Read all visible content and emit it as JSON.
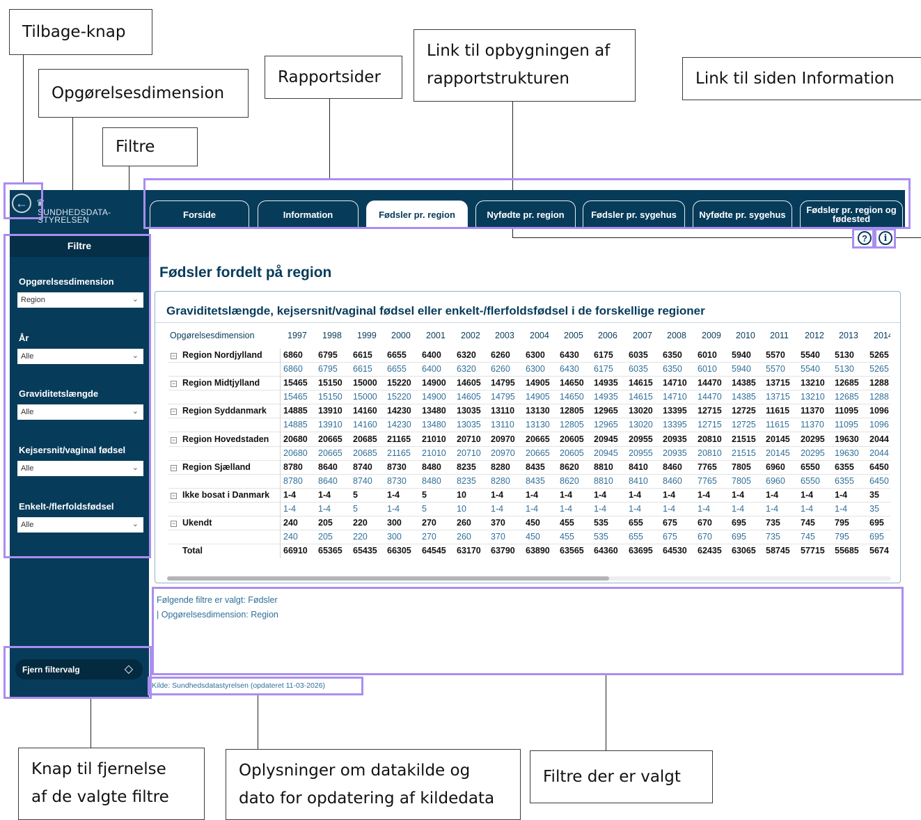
{
  "callouts": {
    "back": "Tilbage-knap",
    "dimension": "Opgørelsesdimension",
    "filters": "Filtre",
    "report_pages": "Rapportsider",
    "structure_line1": "Link til opbygningen af",
    "structure_line2": "rapportstrukturen",
    "information": "Link til siden Information",
    "clear_line1": "Knap til fjernelse",
    "clear_line2": "af de valgte filtre",
    "source_line1": "Oplysninger om datakilde og",
    "source_line2": "dato for opdatering af kildedata",
    "selected_filters": "Filtre der er valgt"
  },
  "logo": {
    "line1": "SUNDHEDSDATA-",
    "line2": "STYRELSEN"
  },
  "tabs": [
    "Forside",
    "Information",
    "Fødsler pr. region",
    "Nyfødte pr. region",
    "Fødsler pr. sygehus",
    "Nyfødte pr. sygehus",
    "Fødsler pr. region og fødested"
  ],
  "active_tab": "Fødsler pr. region",
  "sidebar": {
    "title": "Filtre",
    "filters": [
      {
        "label": "Opgørelsesdimension",
        "value": "Region"
      },
      {
        "label": "År",
        "value": "Alle"
      },
      {
        "label": "Graviditetslængde",
        "value": "Alle"
      },
      {
        "label": "Kejsersnit/vaginal fødsel",
        "value": "Alle"
      },
      {
        "label": "Enkelt-/flerfoldsfødsel",
        "value": "Alle"
      }
    ],
    "clear_button": "Fjern filtervalg"
  },
  "page_title": "Fødsler fordelt på region",
  "table": {
    "title": "Graviditetslængde, kejsersnit/vaginal fødsel eller enkelt-/flerfoldsfødsel i de forskellige regioner",
    "dimension_header": "Opgørelsesdimension",
    "years": [
      "1997",
      "1998",
      "1999",
      "2000",
      "2001",
      "2002",
      "2003",
      "2004",
      "2005",
      "2006",
      "2007",
      "2008",
      "2009",
      "2010",
      "2011",
      "2012",
      "2013",
      "2014"
    ],
    "rows": [
      {
        "label": "Region Nordjylland",
        "values": [
          "6860",
          "6795",
          "6615",
          "6655",
          "6400",
          "6320",
          "6260",
          "6300",
          "6430",
          "6175",
          "6035",
          "6350",
          "6010",
          "5940",
          "5570",
          "5540",
          "5130",
          "5265"
        ]
      },
      {
        "label": "Region Midtjylland",
        "values": [
          "15465",
          "15150",
          "15000",
          "15220",
          "14900",
          "14605",
          "14795",
          "14905",
          "14650",
          "14935",
          "14615",
          "14710",
          "14470",
          "14385",
          "13715",
          "13210",
          "12685",
          "1288"
        ]
      },
      {
        "label": "Region Syddanmark",
        "values": [
          "14885",
          "13910",
          "14160",
          "14230",
          "13480",
          "13035",
          "13110",
          "13130",
          "12805",
          "12965",
          "13020",
          "13395",
          "12715",
          "12725",
          "11615",
          "11370",
          "11095",
          "1096"
        ]
      },
      {
        "label": "Region Hovedstaden",
        "values": [
          "20680",
          "20665",
          "20685",
          "21165",
          "21010",
          "20710",
          "20970",
          "20665",
          "20605",
          "20945",
          "20955",
          "20935",
          "20810",
          "21515",
          "20145",
          "20295",
          "19630",
          "2044"
        ]
      },
      {
        "label": "Region Sjælland",
        "values": [
          "8780",
          "8640",
          "8740",
          "8730",
          "8480",
          "8235",
          "8280",
          "8435",
          "8620",
          "8810",
          "8410",
          "8460",
          "7765",
          "7805",
          "6960",
          "6550",
          "6355",
          "6450"
        ]
      },
      {
        "label": "Ikke bosat i Danmark",
        "values": [
          "1-4",
          "1-4",
          "5",
          "1-4",
          "5",
          "10",
          "1-4",
          "1-4",
          "1-4",
          "1-4",
          "1-4",
          "1-4",
          "1-4",
          "1-4",
          "1-4",
          "1-4",
          "1-4",
          "35"
        ]
      },
      {
        "label": "Ukendt",
        "values": [
          "240",
          "205",
          "220",
          "300",
          "270",
          "260",
          "370",
          "450",
          "455",
          "535",
          "655",
          "675",
          "670",
          "695",
          "735",
          "745",
          "795",
          "695"
        ]
      }
    ],
    "total": {
      "label": "Total",
      "values": [
        "66910",
        "65365",
        "65435",
        "66305",
        "64545",
        "63170",
        "63790",
        "63890",
        "63565",
        "64360",
        "63695",
        "64530",
        "62435",
        "63065",
        "58745",
        "57715",
        "55685",
        "5674"
      ]
    }
  },
  "selected_filters": {
    "line1": "Følgende filtre er valgt: Fødsler",
    "line2": "| Opgørelsesdimension: Region"
  },
  "source": "Kilde: Sundhedsdatastyrelsen (opdateret 11-03-2026)",
  "icons": {
    "back": "back-arrow-icon",
    "help": "question-icon",
    "info": "info-icon",
    "eraser": "eraser-icon",
    "crown": "crown-icon"
  },
  "colors": {
    "navy": "#073b5a",
    "highlight": "#a98ef0",
    "link_blue": "#2f6f9a"
  }
}
